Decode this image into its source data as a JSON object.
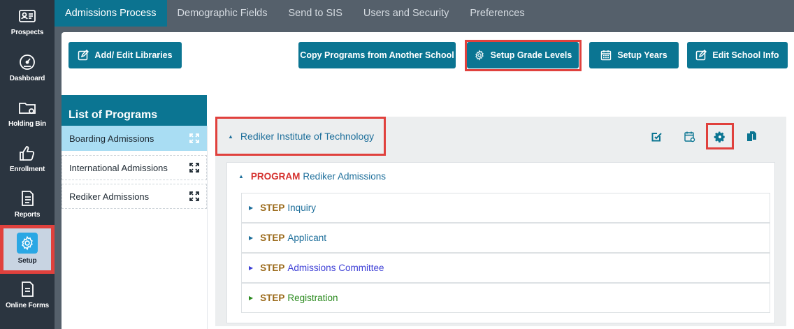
{
  "sidebar": {
    "items": [
      {
        "label": "Prospects",
        "icon": "id-card-icon"
      },
      {
        "label": "Dashboard",
        "icon": "gauge-icon"
      },
      {
        "label": "Holding Bin",
        "icon": "folder-icon"
      },
      {
        "label": "Enrollment",
        "icon": "thumbs-up-icon"
      },
      {
        "label": "Reports",
        "icon": "document-icon"
      },
      {
        "label": "Setup",
        "icon": "gear-icon",
        "active": true
      },
      {
        "label": "Online Forms",
        "icon": "form-icon"
      }
    ]
  },
  "tabs": [
    {
      "label": "Admissions Process",
      "active": true
    },
    {
      "label": "Demographic Fields"
    },
    {
      "label": "Send to SIS"
    },
    {
      "label": "Users and Security"
    },
    {
      "label": "Preferences"
    }
  ],
  "toolbar": {
    "add_edit_libraries": "Add/ Edit Libraries",
    "copy_programs": "Copy Programs from Another School",
    "setup_grade_levels": "Setup Grade Levels",
    "setup_years": "Setup Years",
    "edit_school_info": "Edit School Info"
  },
  "programs_list": {
    "title": "List of Programs",
    "items": [
      {
        "label": "Boarding Admissions",
        "selected": true
      },
      {
        "label": "International Admissions"
      },
      {
        "label": "Rediker Admissions"
      }
    ]
  },
  "institute": {
    "name": "Rediker Institute of Technology"
  },
  "program": {
    "keyword": "PROGRAM",
    "name": "Rediker Admissions",
    "step_keyword": "STEP",
    "steps": [
      {
        "name": "Inquiry",
        "color": "#1e6f9b"
      },
      {
        "name": "Applicant",
        "color": "#1e6f9b"
      },
      {
        "name": "Admissions Committee",
        "color": "#3d3fd6"
      },
      {
        "name": "Registration",
        "color": "#2a8a1e"
      }
    ]
  },
  "colors": {
    "accent": "#0b7592",
    "highlight": "#e0413d",
    "rail": "#2b3540",
    "selected": "#a9ddf3"
  }
}
